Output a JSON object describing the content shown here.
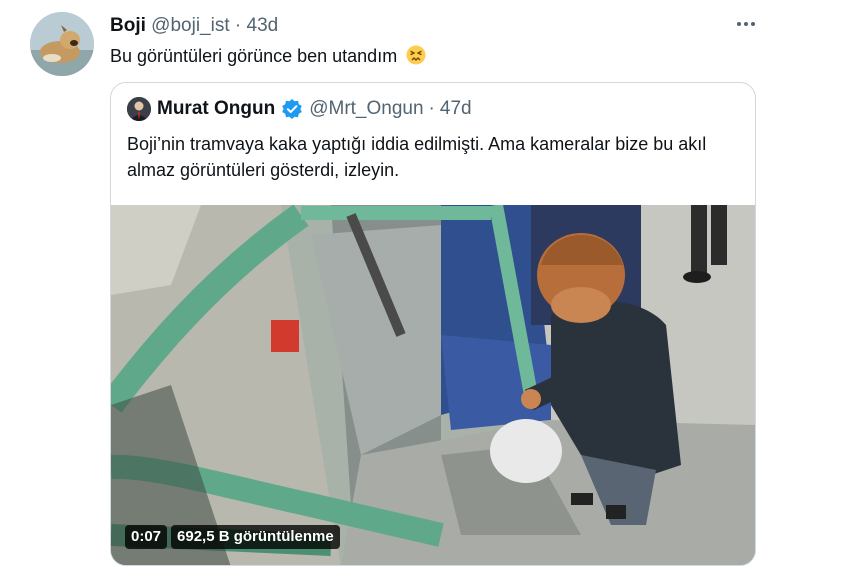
{
  "tweet": {
    "author_name": "Boji",
    "author_handle": "@boji_ist",
    "separator": "·",
    "age": "43d",
    "text": "Bu görüntüleri görünce ben utandım",
    "emoji": "confounded-face-emoji",
    "more_icon": "more-icon"
  },
  "quote": {
    "author_name": "Murat Ongun",
    "author_handle": "@Mrt_Ongun",
    "separator": "·",
    "age": "47d",
    "verified_icon": "verified-badge-icon",
    "text": "Boji’nin tramvaya kaka yaptığı iddia edilmişti. Ama kameralar bize bu akıl almaz görüntüleri gösterdi, izleyin.",
    "video": {
      "duration": "0:07",
      "views": "692,5 B görüntülenme"
    }
  },
  "colors": {
    "text": "#0f1419",
    "muted": "#536471",
    "border": "#cfd9de",
    "verified": "#1d9bf0"
  }
}
